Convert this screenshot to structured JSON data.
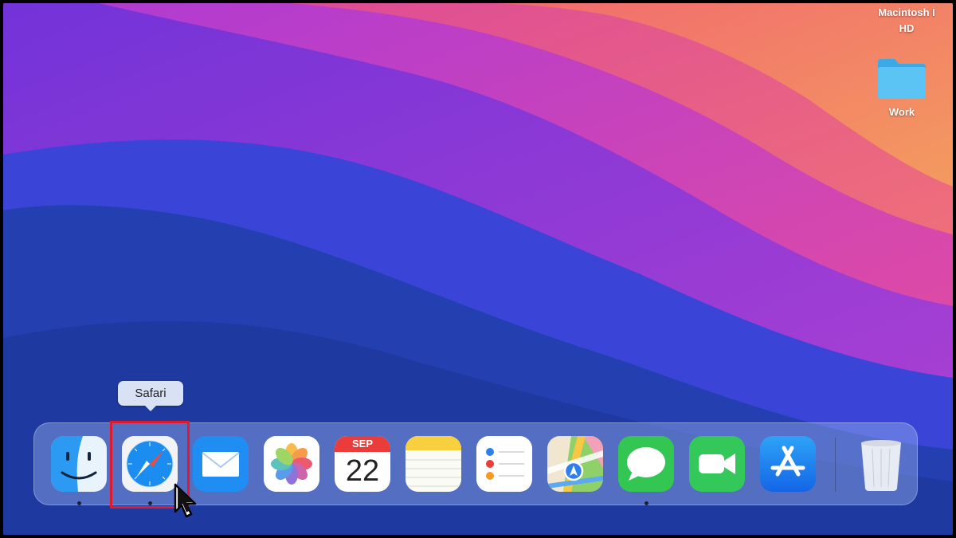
{
  "desktop": {
    "disk_label_line1": "Macintosh I",
    "disk_label_line2": "HD",
    "folder_label": "Work"
  },
  "tooltip": {
    "text": "Safari"
  },
  "dock": {
    "apps": [
      {
        "name": "Finder",
        "icon": "finder-icon",
        "running": true
      },
      {
        "name": "Safari",
        "icon": "safari-icon",
        "running": true,
        "hovered": true
      },
      {
        "name": "Mail",
        "icon": "mail-icon",
        "running": false
      },
      {
        "name": "Photos",
        "icon": "photos-icon",
        "running": false
      },
      {
        "name": "Calendar",
        "icon": "calendar-icon",
        "running": false
      },
      {
        "name": "Notes",
        "icon": "notes-icon",
        "running": false
      },
      {
        "name": "Reminders",
        "icon": "reminders-icon",
        "running": false
      },
      {
        "name": "Maps",
        "icon": "maps-icon",
        "running": false
      },
      {
        "name": "Messages",
        "icon": "messages-icon",
        "running": true
      },
      {
        "name": "FaceTime",
        "icon": "facetime-icon",
        "running": false
      },
      {
        "name": "App Store",
        "icon": "app-store-icon",
        "running": false
      },
      {
        "name": "Trash",
        "icon": "trash-icon",
        "running": false
      }
    ],
    "calendar": {
      "month": "SEP",
      "day": "22"
    }
  },
  "colors": {
    "highlight_box": "#e0192c",
    "dock_background": "#96afeb",
    "tooltip_background": "#d9e1f4"
  }
}
